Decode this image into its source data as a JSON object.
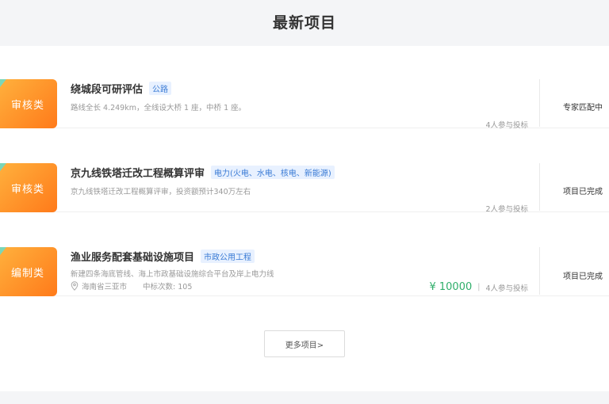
{
  "header": {
    "title": "最新项目"
  },
  "projects": [
    {
      "badge": "审核类",
      "title": "绕城段可研评估",
      "tag": "公路",
      "desc": "路线全长 4.249km，全线设大桥 1 座，中桥 1 座。",
      "participants": "4人参与投标",
      "status": "专家匹配中"
    },
    {
      "badge": "审核类",
      "title": "京九线铁塔迁改工程概算评审",
      "tag": "电力(火电、水电、核电、新能源)",
      "desc": "京九线铁塔迁改工程概算评审，投资额预计340万左右",
      "participants": "2人参与投标",
      "status": "项目已完成"
    },
    {
      "badge": "编制类",
      "title": "渔业服务配套基础设施项目",
      "tag": "市政公用工程",
      "desc": "新建四条海底管线、海上市政基础设施综合平台及岸上电力线",
      "location": "海南省三亚市",
      "bids_label": "中标次数: 105",
      "price": "¥ 10000",
      "participants": "4人参与投标",
      "status": "项目已完成"
    }
  ],
  "more_button": {
    "label": "更多项目>"
  }
}
